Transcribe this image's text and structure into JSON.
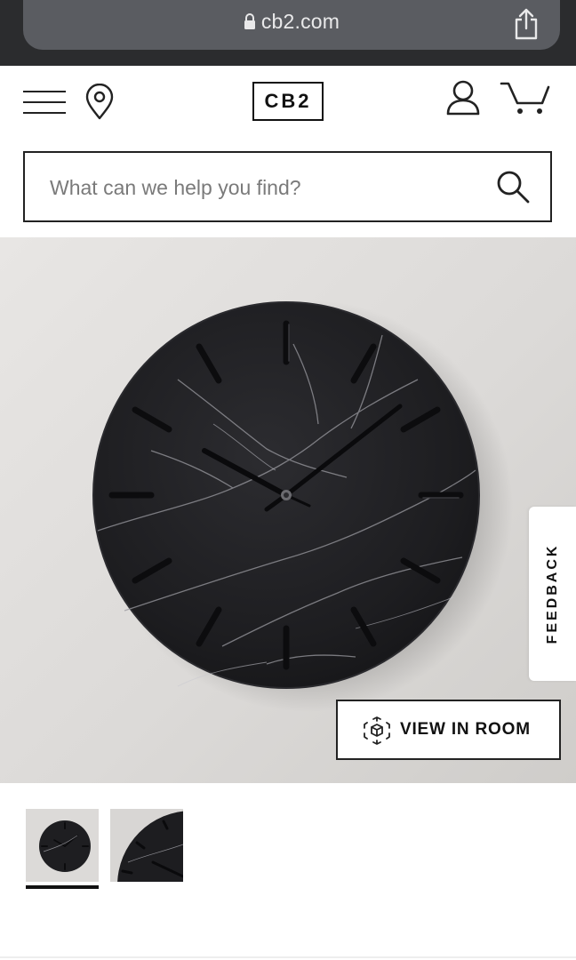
{
  "browser": {
    "url": "cb2.com",
    "lock_icon": "lock-icon",
    "share_icon": "share-icon"
  },
  "header": {
    "menu_icon": "hamburger-icon",
    "location_icon": "location-pin-icon",
    "logo": "CB2",
    "account_icon": "user-icon",
    "cart_icon": "cart-icon"
  },
  "search": {
    "placeholder": "What can we help you find?",
    "value": "",
    "icon": "search-icon"
  },
  "product": {
    "feedback_label": "FEEDBACK",
    "view_in_room_label": "VIEW IN ROOM",
    "view_in_room_icon": "ar-cube-icon",
    "thumbnails": [
      "thumbnail-1",
      "thumbnail-2"
    ],
    "selected_thumbnail": 1
  },
  "colors": {
    "brand": "#111111",
    "browser_bar": "#2b2c2e",
    "url_pill": "#5a5c61",
    "clock_face": "#1f1f22"
  }
}
